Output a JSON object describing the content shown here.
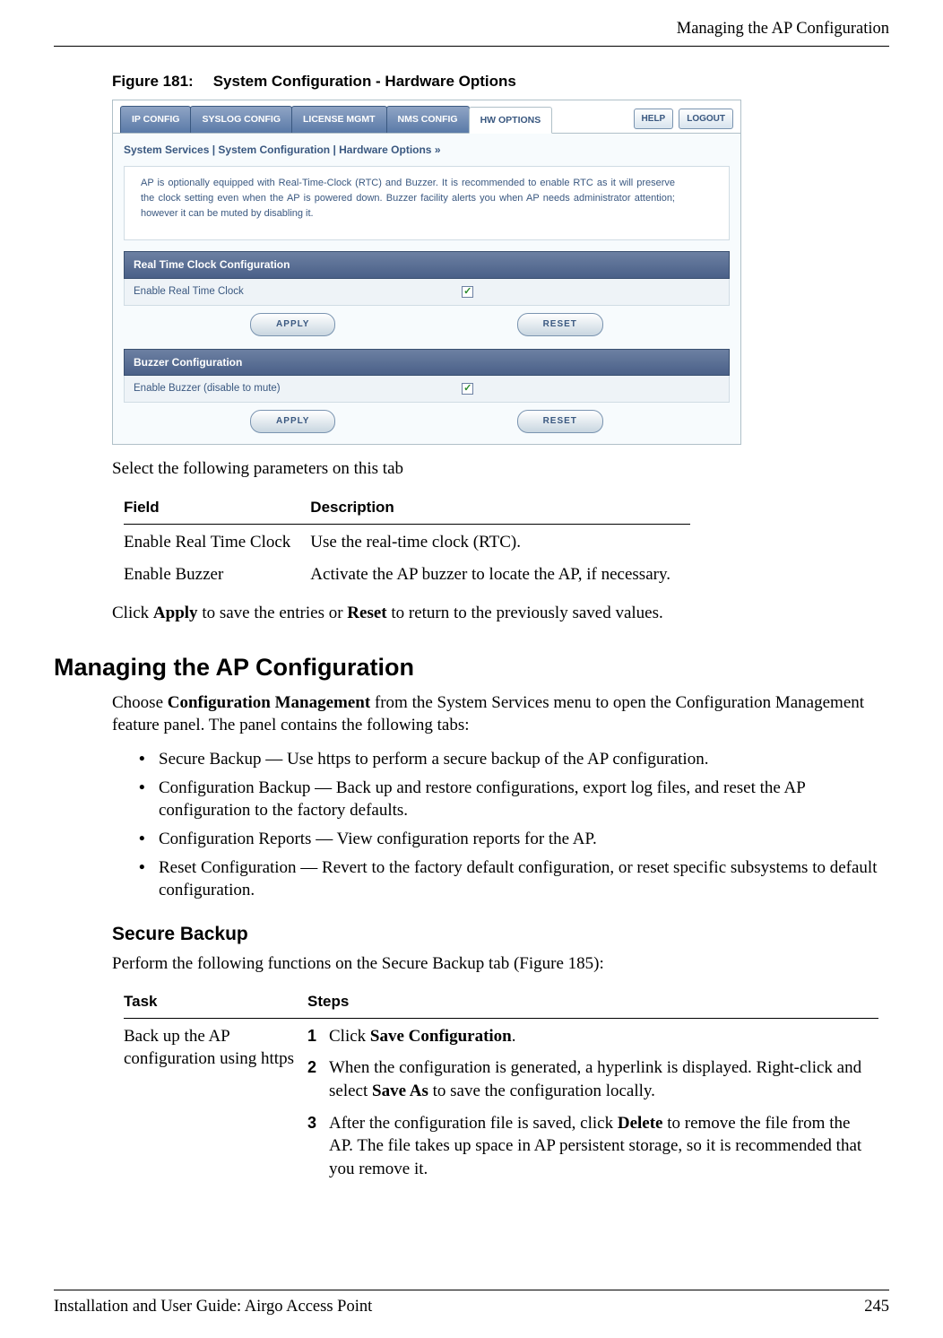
{
  "header": {
    "running_title": "Managing the AP Configuration"
  },
  "figure": {
    "label": "Figure 181:",
    "title": "System Configuration - Hardware Options"
  },
  "screenshot": {
    "tabs": [
      "IP CONFIG",
      "SYSLOG CONFIG",
      "LICENSE MGMT",
      "NMS CONFIG",
      "HW OPTIONS"
    ],
    "top_buttons": {
      "help": "HELP",
      "logout": "LOGOUT"
    },
    "breadcrumb": "System Services | System Configuration | Hardware Options  »",
    "description": "AP is optionally equipped with Real-Time-Clock (RTC) and Buzzer. It is recommended to enable RTC as it will preserve the clock setting even when the AP is powered down. Buzzer facility alerts you when AP needs administrator attention; however it can be muted by disabling it.",
    "section_rtc": {
      "header": "Real Time Clock Configuration",
      "row_label": "Enable Real Time Clock",
      "checked": "✓",
      "apply": "APPLY",
      "reset": "RESET"
    },
    "section_buzzer": {
      "header": "Buzzer Configuration",
      "row_label": "Enable Buzzer (disable to mute)",
      "checked": "✓",
      "apply": "APPLY",
      "reset": "RESET"
    }
  },
  "para1": "Select the following parameters on this tab",
  "field_table": {
    "h1": "Field",
    "h2": "Description",
    "rows": [
      {
        "f": "Enable Real Time Clock",
        "d": "Use the real-time clock (RTC)."
      },
      {
        "f": "Enable Buzzer",
        "d": "Activate the AP buzzer to locate the AP, if necessary."
      }
    ]
  },
  "para2_pre": "Click ",
  "para2_b1": "Apply",
  "para2_mid": " to save the entries or ",
  "para2_b2": "Reset",
  "para2_post": " to return to the previously saved values.",
  "h1": "Managing the AP Configuration",
  "para3_pre": "Choose ",
  "para3_b": "Configuration Management",
  "para3_post": " from the System Services menu to open the Configuration Management feature panel. The panel contains the following tabs:",
  "bullets": [
    "Secure Backup — Use https to perform a secure backup of the AP configuration.",
    "Configuration Backup — Back up and restore configurations, export log files, and reset the AP configuration to the factory defaults.",
    "Configuration Reports — View configuration reports for the AP.",
    "Reset Configuration — Revert to the factory default configuration, or reset specific subsystems to default configuration."
  ],
  "h2": "Secure Backup",
  "para4": "Perform the following functions on the Secure Backup tab (Figure 185):",
  "task_table": {
    "h1": "Task",
    "h2": "Steps",
    "task": "Back up the AP configuration using https",
    "steps": {
      "s1_pre": "Click ",
      "s1_b": "Save Configuration",
      "s1_post": ".",
      "s2_pre": "When the configuration is generated, a hyperlink is displayed. Right-click and select ",
      "s2_b": "Save As",
      "s2_post": " to save the configuration locally.",
      "s3_pre": "After the configuration file is saved, click ",
      "s3_b": "Delete",
      "s3_post": " to remove the file from the AP. The file takes up space in AP persistent storage, so it is recommended that you remove it."
    }
  },
  "footer": {
    "left": "Installation and User Guide: Airgo Access Point",
    "right": "245"
  }
}
